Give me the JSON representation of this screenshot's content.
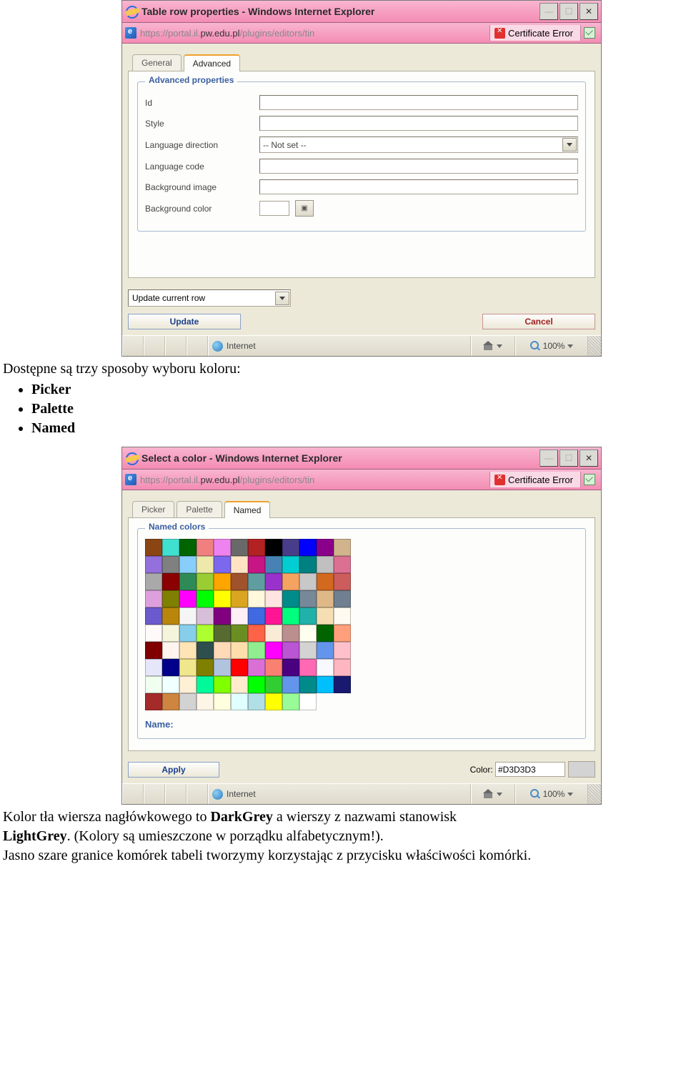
{
  "win1": {
    "title": "Table row properties - Windows Internet Explorer",
    "url_gray_pre": "https://portal.il.",
    "url_dark": "pw.edu.pl",
    "url_gray_post": "/plugins/editors/tin",
    "cert_error": "Certificate Error",
    "tabs": {
      "general": "General",
      "advanced": "Advanced"
    },
    "fieldset_title": "Advanced properties",
    "fields": {
      "id": "Id",
      "style": "Style",
      "langdir": "Language direction",
      "langdir_value": "-- Not set --",
      "langcode": "Language code",
      "bgimage": "Background image",
      "bgcolor": "Background color"
    },
    "scope_value": "Update current row",
    "update_btn": "Update",
    "cancel_btn": "Cancel",
    "status_zone": "Internet",
    "status_zoom": "100%"
  },
  "doc1": {
    "intro": "Dostępne są trzy sposoby wyboru koloru:",
    "b1": "Picker",
    "b2": "Palette",
    "b3": "Named"
  },
  "win2": {
    "title": "Select a color - Windows Internet Explorer",
    "url_gray_pre": "https://portal.il.",
    "url_dark": "pw.edu.pl",
    "url_gray_post": "/plugins/editors/tin",
    "cert_error": "Certificate Error",
    "tabs": {
      "picker": "Picker",
      "palette": "Palette",
      "named": "Named"
    },
    "fieldset_title": "Named colors",
    "name_label": "Name:",
    "apply_btn": "Apply",
    "color_label": "Color:",
    "color_value": "#D3D3D3",
    "status_zone": "Internet",
    "status_zoom": "100%",
    "swatches": [
      "#8B4513",
      "#40E0D0",
      "#006400",
      "#F08080",
      "#EE82EE",
      "#696969",
      "#B22222",
      "#000000",
      "#483D8B",
      "#0000FF",
      "#8B008B",
      "#D2B48C",
      "#9370DB",
      "#808080",
      "#87CEFA",
      "#EEE8AA",
      "#7B68EE",
      "#FFE4C4",
      "#C71585",
      "#4682B4",
      "#00CED1",
      "#008080",
      "#C0C0C0",
      "#DB7093",
      "#A9A9A9",
      "#8B0000",
      "#2E8B57",
      "#9ACD32",
      "#FFA500",
      "#A0522D",
      "#5F9EA0",
      "#9932CC",
      "#F4A460",
      "#C8C8C8",
      "#D2691E",
      "#CD5C5C",
      "#DDA0DD",
      "#808000",
      "#FF00FF",
      "#00FF00",
      "#FFFF00",
      "#DAA520",
      "#FFF8DC",
      "#FFE4E1",
      "#008B8B",
      "#778899",
      "#DEB887",
      "#708090",
      "#6A5ACD",
      "#B8860B",
      "#F5F5F5",
      "#D8BFD8",
      "#800080",
      "#FFF0F5",
      "#4169E1",
      "#FF1493",
      "#00FF7F",
      "#20B2AA",
      "#F5DEB3",
      "#FFFAF0",
      "#FFFAFA",
      "#F5F5DC",
      "#87CEEB",
      "#ADFF2F",
      "#556B2F",
      "#6B8E23",
      "#FF6347",
      "#FAEBD7",
      "#BC8F8F",
      "#FFFFF0",
      "#006400",
      "#FFA07A",
      "#800000",
      "#FFF5EE",
      "#FFE4B5",
      "#2F4F4F",
      "#FFDAB9",
      "#FFDEAD",
      "#90EE90",
      "#FF00FF",
      "#BA55D3",
      "#D3D3D3",
      "#6495ED",
      "#FFC0CB",
      "#E6E6FA",
      "#00008B",
      "#F0E68C",
      "#808000",
      "#B0C4DE",
      "#FF0000",
      "#DA70D6",
      "#FA8072",
      "#4B0082",
      "#FF69B4",
      "#F8F8FF",
      "#FFB6C1",
      "#F0FFF0",
      "#F0FFFF",
      "#FFEFD5",
      "#00FA9A",
      "#7FFF00",
      "#FFEBCD",
      "#00FF00",
      "#32CD32",
      "#6495ED",
      "#008B8B",
      "#00BFFF",
      "#191970",
      "#A52A2A",
      "#CD853F",
      "#D3D3D3",
      "#FDF5E6",
      "#FFFFE0",
      "#E0FFFF",
      "#B0E0E6",
      "#FFFF00",
      "#98FB98",
      "#FFFFFF"
    ]
  },
  "doc2": {
    "p1a": "Kolor tła wiersza nagłówkowego to ",
    "p1b": "DarkGrey",
    "p1c": " a wierszy z nazwami stanowisk ",
    "p1d": "LightGrey",
    "p1e": ". (Kolory są umieszczone w porządku alfabetycznym!).",
    "p2": "Jasno szare granice komórek tabeli tworzymy korzystając z przycisku właściwości komórki."
  }
}
